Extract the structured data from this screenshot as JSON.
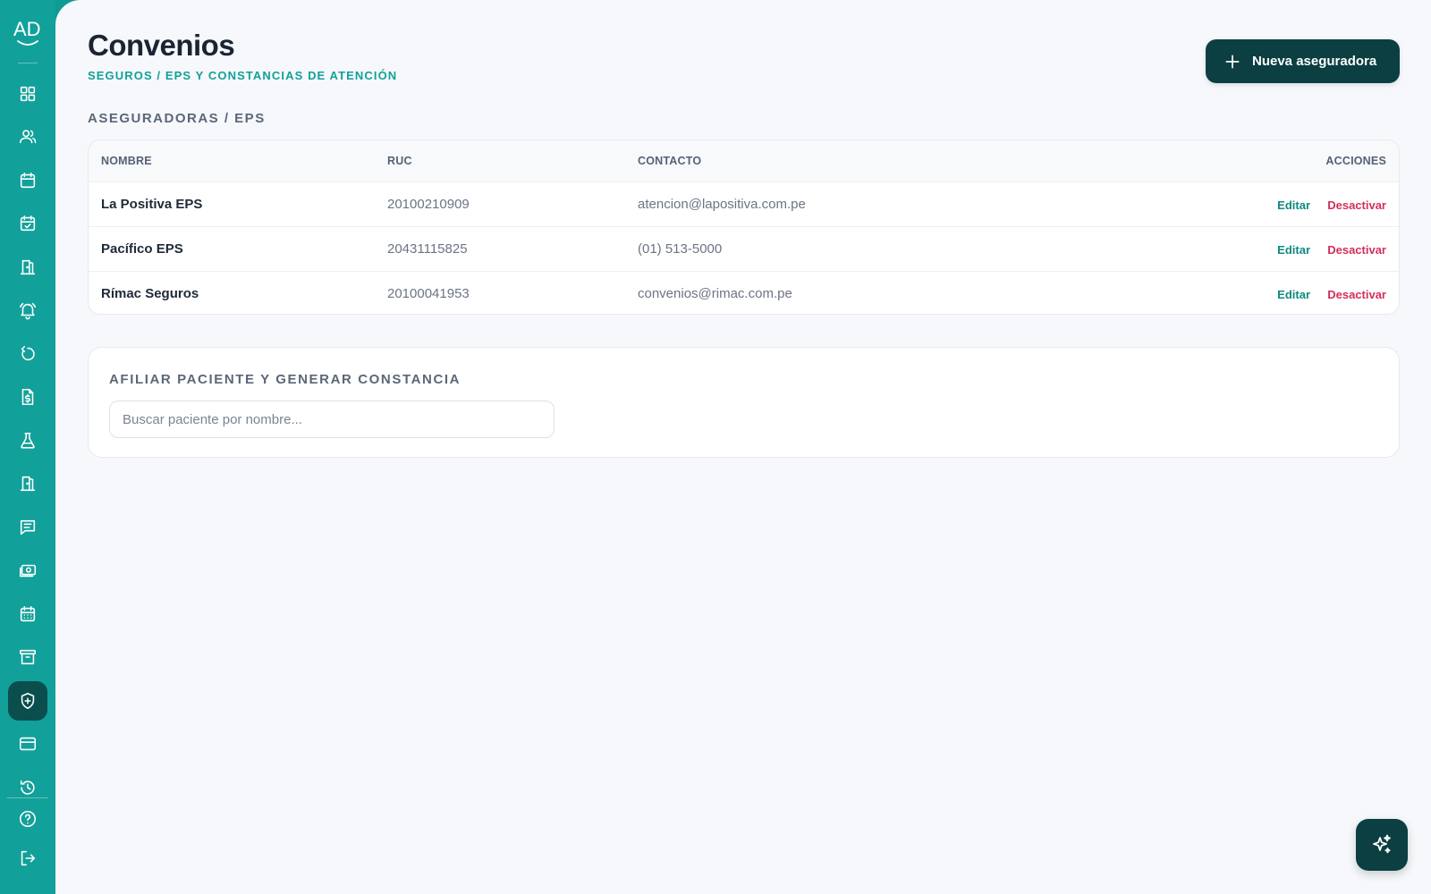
{
  "sidebar": {
    "logo_text": "AD",
    "items": [
      {
        "icon": "dashboard-grid-icon"
      },
      {
        "icon": "users-icon"
      },
      {
        "icon": "calendar-icon"
      },
      {
        "icon": "calendar-check-icon"
      },
      {
        "icon": "door-icon"
      },
      {
        "icon": "bell-icon"
      },
      {
        "icon": "refresh-icon"
      },
      {
        "icon": "invoice-icon"
      },
      {
        "icon": "flask-icon"
      },
      {
        "icon": "door-icon"
      },
      {
        "icon": "message-icon"
      },
      {
        "icon": "cash-icon"
      },
      {
        "icon": "calendar-grid-icon"
      },
      {
        "icon": "archive-icon"
      },
      {
        "icon": "shield-plus-icon",
        "active": true
      },
      {
        "icon": "credit-card-icon"
      },
      {
        "icon": "history-icon"
      }
    ],
    "bottom": [
      {
        "icon": "help-icon"
      },
      {
        "icon": "logout-icon"
      }
    ]
  },
  "header": {
    "title": "Convenios",
    "subtitle": "SEGUROS / EPS Y CONSTANCIAS DE ATENCIÓN",
    "new_button_label": "Nueva aseguradora"
  },
  "insurers": {
    "section_title": "ASEGURADORAS / EPS",
    "columns": {
      "name": "NOMBRE",
      "ruc": "RUC",
      "contact": "CONTACTO",
      "actions": "ACCIONES"
    },
    "rows": [
      {
        "name": "La Positiva EPS",
        "ruc": "20100210909",
        "contact": "atencion@lapositiva.com.pe",
        "edit": "Editar",
        "deactivate": "Desactivar"
      },
      {
        "name": "Pacífico EPS",
        "ruc": "20431115825",
        "contact": "(01) 513-5000",
        "edit": "Editar",
        "deactivate": "Desactivar"
      },
      {
        "name": "Rímac Seguros",
        "ruc": "20100041953",
        "contact": "convenios@rimac.com.pe",
        "edit": "Editar",
        "deactivate": "Desactivar"
      }
    ]
  },
  "affiliate": {
    "title": "AFILIAR PACIENTE Y GENERAR CONSTANCIA",
    "search_placeholder": "Buscar paciente por nombre..."
  },
  "colors": {
    "sidebar": "#12a09a",
    "primary_dark": "#0b3f42",
    "accent_teal": "#12a09a",
    "danger": "#d42f5c"
  }
}
